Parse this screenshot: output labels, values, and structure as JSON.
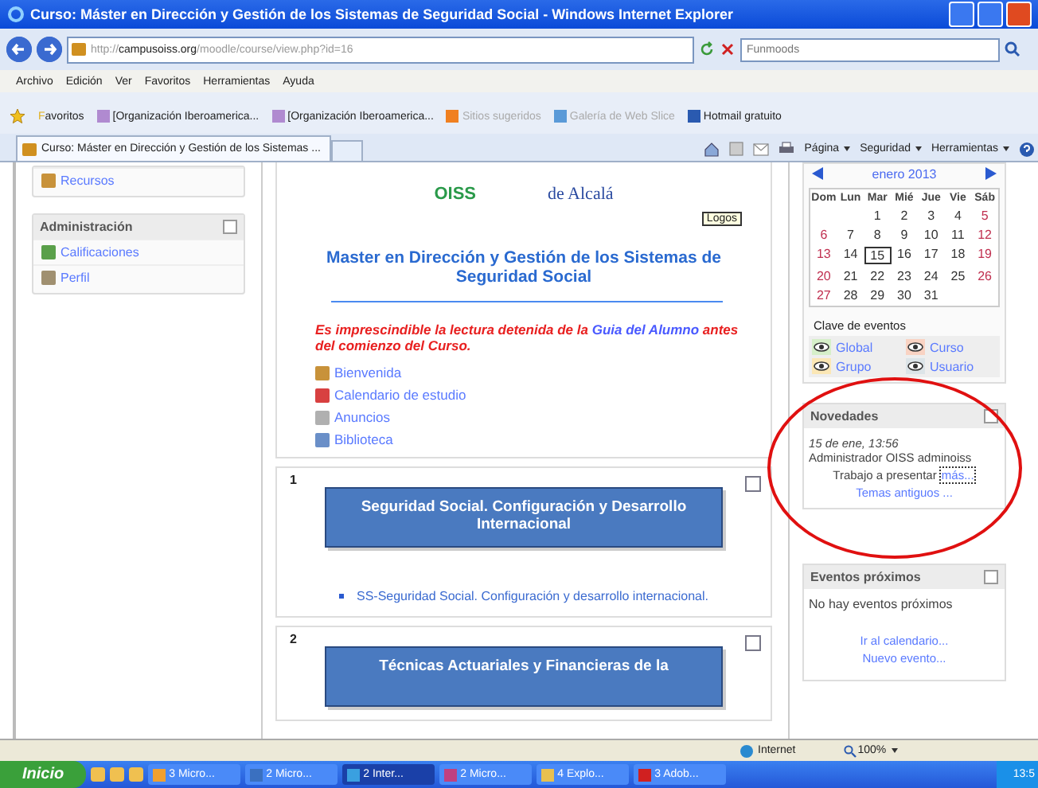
{
  "window": {
    "title": "Curso: Máster en Dirección y Gestión de los Sistemas de Seguridad Social - Windows Internet Explorer"
  },
  "address": {
    "scheme": "http://",
    "host": "campusoiss.org",
    "path": "/moodle/course/view.php?id=16"
  },
  "search": {
    "placeholder": "Funmoods"
  },
  "menu": [
    "Archivo",
    "Edición",
    "Ver",
    "Favoritos",
    "Herramientas",
    "Ayuda"
  ],
  "favorites": {
    "label": "Favoritos",
    "items": [
      {
        "label": "[Organización Iberoamerica...",
        "disabled": false,
        "kind": "site"
      },
      {
        "label": "[Organización Iberoamerica...",
        "disabled": false,
        "kind": "site"
      },
      {
        "label": "Sitios sugeridos",
        "disabled": true,
        "kind": "suggest"
      },
      {
        "label": "Galería de Web Slice",
        "disabled": true,
        "kind": "slice"
      },
      {
        "label": "Hotmail gratuito",
        "disabled": false,
        "kind": "mail"
      }
    ]
  },
  "tab": {
    "label": "Curso: Máster en Dirección y Gestión de los Sistemas ..."
  },
  "command_bar": [
    "Página",
    "Seguridad",
    "Herramientas"
  ],
  "sidebar": {
    "blocks": [
      {
        "items": [
          {
            "label": "Recursos",
            "kind": "resource"
          }
        ]
      },
      {
        "title": "Administración",
        "items": [
          {
            "label": "Calificaciones",
            "kind": "grades"
          },
          {
            "label": "Perfil",
            "kind": "profile"
          }
        ]
      }
    ]
  },
  "course": {
    "logos": {
      "oiss": "OISS",
      "university": "de Alcalá",
      "tooltip": "Logos"
    },
    "title": "Master en Dirección y Gestión de los Sistemas de Seguridad Social",
    "notice": {
      "before": "Es imprescindible la lectura detenida de la ",
      "link": "Guia del Alumno",
      "after": " antes del comienzo del Curso."
    },
    "resources": [
      {
        "label": "Bienvenida",
        "kind": "resource"
      },
      {
        "label": "Calendario de estudio",
        "kind": "calendar"
      },
      {
        "label": "Anuncios",
        "kind": "forum"
      },
      {
        "label": "Biblioteca",
        "kind": "folder"
      }
    ],
    "topics": [
      {
        "number": "1",
        "banner": "Seguridad Social. Configuración y Desarrollo Internacional",
        "links": [
          "SS-Seguridad Social. Configuración y desarrollo internacional."
        ]
      },
      {
        "number": "2",
        "banner": "Técnicas Actuariales y Financieras de la"
      }
    ]
  },
  "calendar": {
    "month": "enero 2013",
    "weekdays": [
      "Dom",
      "Lun",
      "Mar",
      "Mié",
      "Jue",
      "Vie",
      "Sáb"
    ],
    "weeks": [
      [
        {
          "day": "1",
          "today": false
        },
        {
          "day": "2",
          "today": false
        },
        {
          "day": "3",
          "today": false
        },
        {
          "day": "4",
          "today": false
        },
        {
          "day": "5",
          "today": false
        }
      ],
      [
        {
          "day": "6",
          "today": false
        },
        {
          "day": "7",
          "today": false
        },
        {
          "day": "8",
          "today": false
        },
        {
          "day": "9",
          "today": false
        },
        {
          "day": "10",
          "today": false
        },
        {
          "day": "11",
          "today": false
        },
        {
          "day": "12",
          "today": false
        }
      ],
      [
        {
          "day": "13",
          "today": false
        },
        {
          "day": "14",
          "today": false
        },
        {
          "day": "15",
          "today": true
        },
        {
          "day": "16",
          "today": false
        },
        {
          "day": "17",
          "today": false
        },
        {
          "day": "18",
          "today": false
        },
        {
          "day": "19",
          "today": false
        }
      ],
      [
        {
          "day": "20",
          "today": false
        },
        {
          "day": "21",
          "today": false
        },
        {
          "day": "22",
          "today": false
        },
        {
          "day": "23",
          "today": false
        },
        {
          "day": "24",
          "today": false
        },
        {
          "day": "25",
          "today": false
        },
        {
          "day": "26",
          "today": false
        }
      ],
      [
        {
          "day": "27",
          "today": false
        },
        {
          "day": "28",
          "today": false
        },
        {
          "day": "29",
          "today": false
        },
        {
          "day": "30",
          "today": false
        },
        {
          "day": "31",
          "today": false
        }
      ]
    ],
    "key_title": "Clave de eventos",
    "key": [
      {
        "label": "Global",
        "color": "#d6efc9"
      },
      {
        "label": "Curso",
        "color": "#f9d3c3"
      },
      {
        "label": "Grupo",
        "color": "#fbe7b5"
      },
      {
        "label": "Usuario",
        "color": "#dce4e8"
      }
    ]
  },
  "news": {
    "title": "Novedades",
    "date": "15 de ene, 13:56",
    "author": "Administrador OISS adminoiss",
    "subject": "Trabajo a presentar",
    "more": "más...",
    "older": "Temas antiguos ..."
  },
  "upcoming": {
    "title": "Eventos próximos",
    "empty": "No hay eventos próximos",
    "links": [
      "Ir al calendario...",
      "Nuevo evento..."
    ]
  },
  "status_bar": {
    "zone": "Internet",
    "zoom": "100%"
  },
  "taskbar": {
    "start": "Inicio",
    "items": [
      {
        "label": "3 Micro...",
        "selected": false,
        "kind": "chat"
      },
      {
        "label": "2 Micro...",
        "selected": false,
        "kind": "pub"
      },
      {
        "label": "2 Inter...",
        "selected": true,
        "kind": "ie"
      },
      {
        "label": "2 Micro...",
        "selected": false,
        "kind": "proj"
      },
      {
        "label": "4 Explo...",
        "selected": false,
        "kind": "folder"
      },
      {
        "label": "3 Adob...",
        "selected": false,
        "kind": "pdf"
      }
    ],
    "clock": "13:5"
  }
}
